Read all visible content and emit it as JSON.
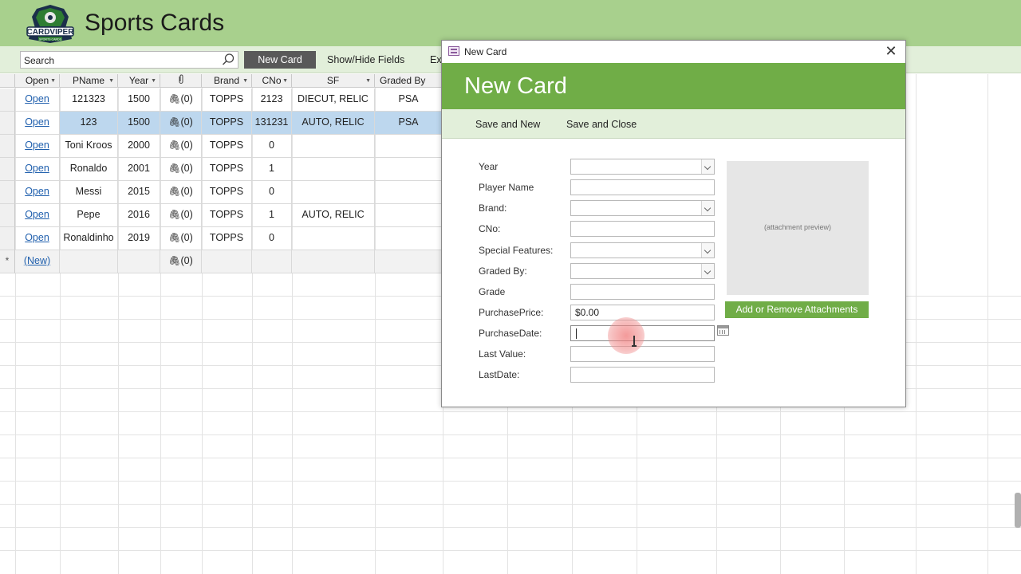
{
  "app": {
    "title": "Sports Cards",
    "logo_text": "CARDVIPER",
    "logo_subtext": "SPORTS CARDS"
  },
  "toolbar": {
    "search_value": "Search",
    "new_card_label": "New Card",
    "show_hide_label": "Show/Hide Fields",
    "export_label": "Ex"
  },
  "grid": {
    "columns": [
      "Open",
      "PName",
      "Year",
      "",
      "Brand",
      "CNo",
      "SF",
      "Graded By"
    ],
    "rows": [
      {
        "open": "Open",
        "pname": "121323",
        "year": "1500",
        "attach": "(0)",
        "brand": "TOPPS",
        "cno": "2123",
        "sf": "DIECUT, RELIC",
        "graded": "PSA"
      },
      {
        "open": "Open",
        "pname": "123",
        "year": "1500",
        "attach": "(0)",
        "brand": "TOPPS",
        "cno": "131231",
        "sf": "AUTO, RELIC",
        "graded": "PSA"
      },
      {
        "open": "Open",
        "pname": "Toni Kroos",
        "year": "2000",
        "attach": "(0)",
        "brand": "TOPPS",
        "cno": "0",
        "sf": "",
        "graded": ""
      },
      {
        "open": "Open",
        "pname": "Ronaldo",
        "year": "2001",
        "attach": "(0)",
        "brand": "TOPPS",
        "cno": "1",
        "sf": "",
        "graded": ""
      },
      {
        "open": "Open",
        "pname": "Messi",
        "year": "2015",
        "attach": "(0)",
        "brand": "TOPPS",
        "cno": "0",
        "sf": "",
        "graded": ""
      },
      {
        "open": "Open",
        "pname": "Pepe",
        "year": "2016",
        "attach": "(0)",
        "brand": "TOPPS",
        "cno": "1",
        "sf": "AUTO, RELIC",
        "graded": ""
      },
      {
        "open": "Open",
        "pname": "Ronaldinho",
        "year": "2019",
        "attach": "(0)",
        "brand": "TOPPS",
        "cno": "0",
        "sf": "",
        "graded": ""
      }
    ],
    "new_row": {
      "marker": "*",
      "open": "(New)",
      "attach": "(0)"
    }
  },
  "dialog": {
    "title": "New Card",
    "heading": "New Card",
    "save_new_label": "Save and New",
    "save_close_label": "Save and Close",
    "close_glyph": "✕",
    "fields": [
      {
        "label": "Year",
        "value": ""
      },
      {
        "label": "Player Name",
        "value": ""
      },
      {
        "label": "Brand:",
        "value": ""
      },
      {
        "label": "CNo:",
        "value": ""
      },
      {
        "label": "Special Features:",
        "value": ""
      },
      {
        "label": "Graded By:",
        "value": ""
      },
      {
        "label": "Grade",
        "value": ""
      },
      {
        "label": "PurchasePrice:",
        "value": "$0.00"
      },
      {
        "label": "PurchaseDate:",
        "value": ""
      },
      {
        "label": "Last Value:",
        "value": ""
      },
      {
        "label": "LastDate:",
        "value": ""
      }
    ],
    "preview_text": "(attachment preview)",
    "attach_button_label": "Add or Remove Attachments"
  },
  "colors": {
    "header": "#a8d08d",
    "toolbar": "#e2efda",
    "accent": "#70ad47",
    "selected_row": "#bdd7ee",
    "link": "#1f5fad"
  },
  "icons": [
    "search-icon",
    "paperclip-icon",
    "form-icon",
    "close-icon",
    "chevron-down-icon",
    "calendar-icon"
  ]
}
